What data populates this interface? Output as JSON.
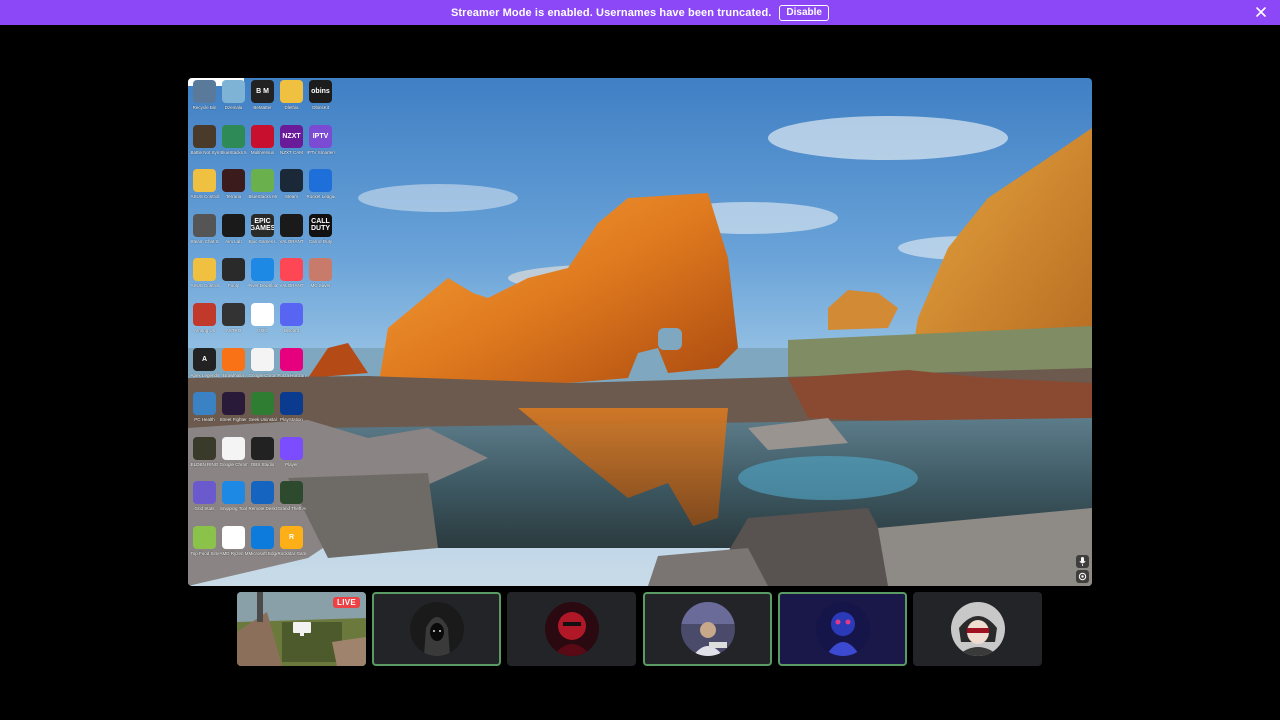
{
  "banner": {
    "message": "Streamer Mode is enabled. Usernames have been truncated.",
    "disable_label": "Disable",
    "background": "#8c47f7"
  },
  "stream": {
    "desktop_icons": [
      {
        "name": "recycle-bin-icon",
        "text": "",
        "label": "Recycle Bin",
        "color": "#5a7a9c"
      },
      {
        "name": "generic-app-icon",
        "text": "",
        "label": "Dzemala",
        "color": "#7fb3d5"
      },
      {
        "name": "bm-app-icon",
        "text": "B M",
        "label": "BeMatter",
        "color": "#222"
      },
      {
        "name": "folder-icon",
        "text": "",
        "label": "Dlethia",
        "color": "#f0c040"
      },
      {
        "name": "obins-icon",
        "text": "obins",
        "label": "ObinsKit",
        "color": "#1c1c1c"
      },
      {
        "name": "game-icon",
        "text": "",
        "label": "Battle Not Synthesize",
        "color": "#4a3a2a"
      },
      {
        "name": "bluestacks-icon",
        "text": "",
        "label": "BlueStacks 5",
        "color": "#2e8b57"
      },
      {
        "name": "multiversus-icon",
        "text": "",
        "label": "MultiVersus",
        "color": "#c8102e"
      },
      {
        "name": "nzxt-icon",
        "text": "NZXT",
        "label": "NZXT CAM",
        "color": "#6a1b9a"
      },
      {
        "name": "iptv-icon",
        "text": "IPTV",
        "label": "IPTV Smarters",
        "color": "#7b4bd4"
      },
      {
        "name": "folder-icon",
        "text": "",
        "label": "ASUS Controller Tool",
        "color": "#f0c040"
      },
      {
        "name": "terraria-icon",
        "text": "",
        "label": "Terraria",
        "color": "#3b1b1b"
      },
      {
        "name": "bluestacks-multi-icon",
        "text": "",
        "label": "BlueStacks Multi-Instance",
        "color": "#6ab04c"
      },
      {
        "name": "steam-icon",
        "text": "",
        "label": "Steam",
        "color": "#1b2838"
      },
      {
        "name": "rocket-league-icon",
        "text": "",
        "label": "Rocket League",
        "color": "#1e6fd9"
      },
      {
        "name": "steam-cleaner-icon",
        "text": "",
        "label": "Steam Chat Shortcut",
        "color": "#555"
      },
      {
        "name": "aimlab-icon",
        "text": "",
        "label": "Aim Lab",
        "color": "#1a1a1a"
      },
      {
        "name": "epic-games-icon",
        "text": "EPIC GAMES",
        "label": "Epic Games Launcher",
        "color": "#2a2a2a"
      },
      {
        "name": "valorant-icon",
        "text": "",
        "label": "VALORANT",
        "color": "#1a1a1a"
      },
      {
        "name": "call-of-duty-icon",
        "text": "CALL DUTY",
        "label": "Call of Duty",
        "color": "#111"
      },
      {
        "name": "folder-icon",
        "text": "",
        "label": "ASUS Controller",
        "color": "#f0c040"
      },
      {
        "name": "anime-app-icon",
        "text": "",
        "label": "Fooly",
        "color": "#2a2a2a"
      },
      {
        "name": "f-app-icon",
        "text": "",
        "label": "Fiver Download",
        "color": "#1e88e5"
      },
      {
        "name": "valorant-red-icon",
        "text": "",
        "label": "VALORANT",
        "color": "#ff4655"
      },
      {
        "name": "minecraft-icon",
        "text": "",
        "label": "MC Saver",
        "color": "#c97b6b"
      },
      {
        "name": "among-us-icon",
        "text": "",
        "label": "Among Us",
        "color": "#c0392b"
      },
      {
        "name": "xbox-app-icon",
        "text": "",
        "label": "ASTRO",
        "color": "#333"
      },
      {
        "name": "gog-icon",
        "text": "",
        "label": "GOG",
        "color": "#fff"
      },
      {
        "name": "discord-icon",
        "text": "",
        "label": "Discord",
        "color": "#5865f2"
      },
      {
        "name": "empty-slot",
        "text": "",
        "label": "",
        "color": "transparent"
      },
      {
        "name": "apex-icon",
        "text": "A",
        "label": "Apex Legends",
        "color": "#222"
      },
      {
        "name": "origin-icon",
        "text": "",
        "label": "Brawlhalla",
        "color": "#f97316"
      },
      {
        "name": "chrome-icon",
        "text": "",
        "label": "Google Chrome",
        "color": "#f4f4f4"
      },
      {
        "name": "forza-icon",
        "text": "",
        "label": "Forza Horizon",
        "color": "#e6007e"
      },
      {
        "name": "empty-slot",
        "text": "",
        "label": "",
        "color": "transparent"
      },
      {
        "name": "settings-app-icon",
        "text": "",
        "label": "PC Health",
        "color": "#3b82c4"
      },
      {
        "name": "street-fighter-icon",
        "text": "",
        "label": "Street Fighter 6",
        "color": "#2a1a3a"
      },
      {
        "name": "gecko-icon",
        "text": "",
        "label": "Geek Uninstaller",
        "color": "#2e7d32"
      },
      {
        "name": "playstation-icon",
        "text": "",
        "label": "PlayStation",
        "color": "#0b3b8f"
      },
      {
        "name": "empty-slot",
        "text": "",
        "label": "",
        "color": "transparent"
      },
      {
        "name": "game-shield-icon",
        "text": "",
        "label": "ELDEN RING",
        "color": "#3a3a2a"
      },
      {
        "name": "chrome-icon",
        "text": "",
        "label": "Google Chrome",
        "color": "#f4f4f4"
      },
      {
        "name": "obs-icon",
        "text": "",
        "label": "OBS Studio",
        "color": "#222"
      },
      {
        "name": "player-icon",
        "text": "",
        "label": "Player",
        "color": "#7c4dff"
      },
      {
        "name": "empty-slot",
        "text": "",
        "label": "",
        "color": "transparent"
      },
      {
        "name": "bar-chart-app-icon",
        "text": "",
        "label": "Grid Stats",
        "color": "#6a5acd"
      },
      {
        "name": "camera-app-icon",
        "text": "",
        "label": "Snipping Tool",
        "color": "#1e88e5"
      },
      {
        "name": "monitor-app-icon",
        "text": "",
        "label": "Remote Desktop",
        "color": "#1565c0"
      },
      {
        "name": "gta-icon",
        "text": "",
        "label": "Grand Theft Auto V",
        "color": "#2e4a2e"
      },
      {
        "name": "empty-slot",
        "text": "",
        "label": "",
        "color": "transparent"
      },
      {
        "name": "farm-sim-icon",
        "text": "",
        "label": "Top Food Simulator",
        "color": "#8bc34a"
      },
      {
        "name": "amd-icon",
        "text": "",
        "label": "AMD Ryzen Master",
        "color": "#fff"
      },
      {
        "name": "edge-icon",
        "text": "",
        "label": "Microsoft Edge",
        "color": "#0c7bdc"
      },
      {
        "name": "rockstar-icon",
        "text": "R",
        "label": "Rockstar Games",
        "color": "#fcaf17"
      },
      {
        "name": "empty-slot",
        "text": "",
        "label": "",
        "color": "transparent"
      }
    ]
  },
  "tiles": {
    "live_label": "LIVE",
    "speaking_color": "#5a9b63"
  }
}
